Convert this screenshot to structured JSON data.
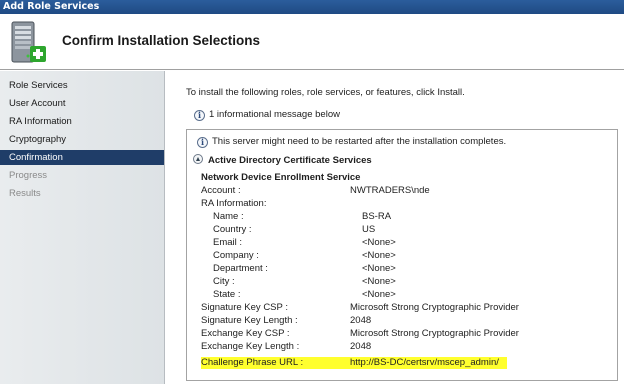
{
  "window": {
    "title": "Add Role Services"
  },
  "header": {
    "page_title": "Confirm Installation Selections",
    "icon": "server-add-icon"
  },
  "sidebar": {
    "items": [
      {
        "label": "Role Services",
        "state": "normal"
      },
      {
        "label": "User Account",
        "state": "normal"
      },
      {
        "label": "RA Information",
        "state": "normal"
      },
      {
        "label": "Cryptography",
        "state": "normal"
      },
      {
        "label": "Confirmation",
        "state": "active"
      },
      {
        "label": "Progress",
        "state": "disabled"
      },
      {
        "label": "Results",
        "state": "disabled"
      }
    ]
  },
  "content": {
    "intro": "To install the following roles, role services, or features, click Install.",
    "info_message": "1 informational message below",
    "restart_warning": "This server might need to be restarted after the installation completes.",
    "section_title": "Active Directory Certificate Services",
    "subsection_title": "Network Device Enrollment Service",
    "rows": [
      {
        "label": "Account :",
        "value": "NWTRADERS\\nde"
      },
      {
        "label": "RA Information:",
        "value": ""
      },
      {
        "label": "Name :",
        "value": "BS-RA"
      },
      {
        "label": "Country :",
        "value": "US"
      },
      {
        "label": "Email :",
        "value": "<None>"
      },
      {
        "label": "Company :",
        "value": "<None>"
      },
      {
        "label": "Department :",
        "value": "<None>"
      },
      {
        "label": "City :",
        "value": "<None>"
      },
      {
        "label": "State :",
        "value": "<None>"
      },
      {
        "label": "Signature Key CSP :",
        "value": "Microsoft Strong Cryptographic Provider"
      },
      {
        "label": "Signature Key Length :",
        "value": "2048"
      },
      {
        "label": "Exchange Key CSP :",
        "value": "Microsoft Strong Cryptographic Provider"
      },
      {
        "label": "Exchange Key Length :",
        "value": "2048"
      },
      {
        "label": "Challenge Phrase URL :",
        "value": "http://BS-DC/certsrv/mscep_admin/"
      }
    ]
  },
  "colors": {
    "titlebar": "#1f4a83",
    "active_nav": "#1f3d68",
    "highlight": "#ffff2e"
  }
}
